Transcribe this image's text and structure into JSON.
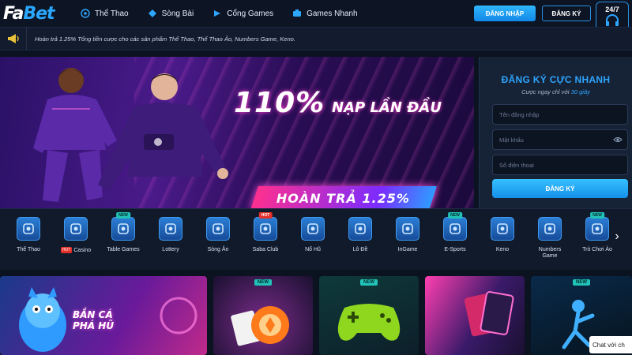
{
  "brand": {
    "logo_prefix": "Fa",
    "logo_suffix": "Bet"
  },
  "nav": {
    "items": [
      {
        "label": "Thể Thao",
        "icon": "soccer-ball-icon"
      },
      {
        "label": "Sòng Bài",
        "icon": "cards-icon"
      },
      {
        "label": "Cổng Games",
        "icon": "gamepad-icon"
      },
      {
        "label": "Games Nhanh",
        "icon": "lightning-icon"
      }
    ],
    "login_label": "ĐĂNG NHẬP",
    "register_label": "ĐĂNG KÝ",
    "support_label": "24/7"
  },
  "marquee": {
    "text": "Hoàn trả 1.25% Tổng tiền cược cho các sản phẩm Thể Thao, Thể Thao Ảo, Numbers Game, Keno."
  },
  "banner": {
    "headline": "110%",
    "headline_sub": "NẠP LẦN ĐẦU",
    "cashback": "HOÀN TRẢ 1.25%"
  },
  "register_panel": {
    "title": "ĐĂNG KÝ CỰC NHANH",
    "subtitle_prefix": "Cược ngay chỉ với",
    "subtitle_highlight": "30 giây",
    "username_placeholder": "Tên đăng nhập",
    "password_placeholder": "Mật khẩu",
    "phone_placeholder": "Số điện thoại",
    "submit_label": "ĐĂNG KÝ"
  },
  "categories": [
    {
      "label": "Thể Thao",
      "badge": "",
      "hot_inline": false
    },
    {
      "label": "Casino",
      "badge": "",
      "hot_inline": true
    },
    {
      "label": "Table Games",
      "badge": "NEW",
      "hot_inline": false
    },
    {
      "label": "Lottery",
      "badge": "",
      "hot_inline": false
    },
    {
      "label": "Sòng Ăn",
      "badge": "",
      "hot_inline": false
    },
    {
      "label": "Saba Club",
      "badge": "HOT",
      "hot_inline": false
    },
    {
      "label": "Nổ Hũ",
      "badge": "",
      "hot_inline": false
    },
    {
      "label": "Lô Đề",
      "badge": "",
      "hot_inline": false
    },
    {
      "label": "InGame",
      "badge": "",
      "hot_inline": false
    },
    {
      "label": "E-Sports",
      "badge": "NEW",
      "hot_inline": false
    },
    {
      "label": "Keno",
      "badge": "",
      "hot_inline": false
    },
    {
      "label": "Numbers\nGame",
      "badge": "",
      "hot_inline": false
    },
    {
      "label": "Trò Chơi Ảo",
      "badge": "NEW",
      "hot_inline": false
    }
  ],
  "category_hot_label": "HOT",
  "tiles": {
    "fish_line1": "BẮN CÁ",
    "fish_line2": "PHÁ HŨ",
    "new_label": "NEW"
  },
  "chat": {
    "label": "Chat với ch"
  },
  "colors": {
    "accent": "#2ea6ff",
    "background": "#0b1220",
    "new_badge": "#21c3b8",
    "hot_badge": "#e4302a"
  }
}
